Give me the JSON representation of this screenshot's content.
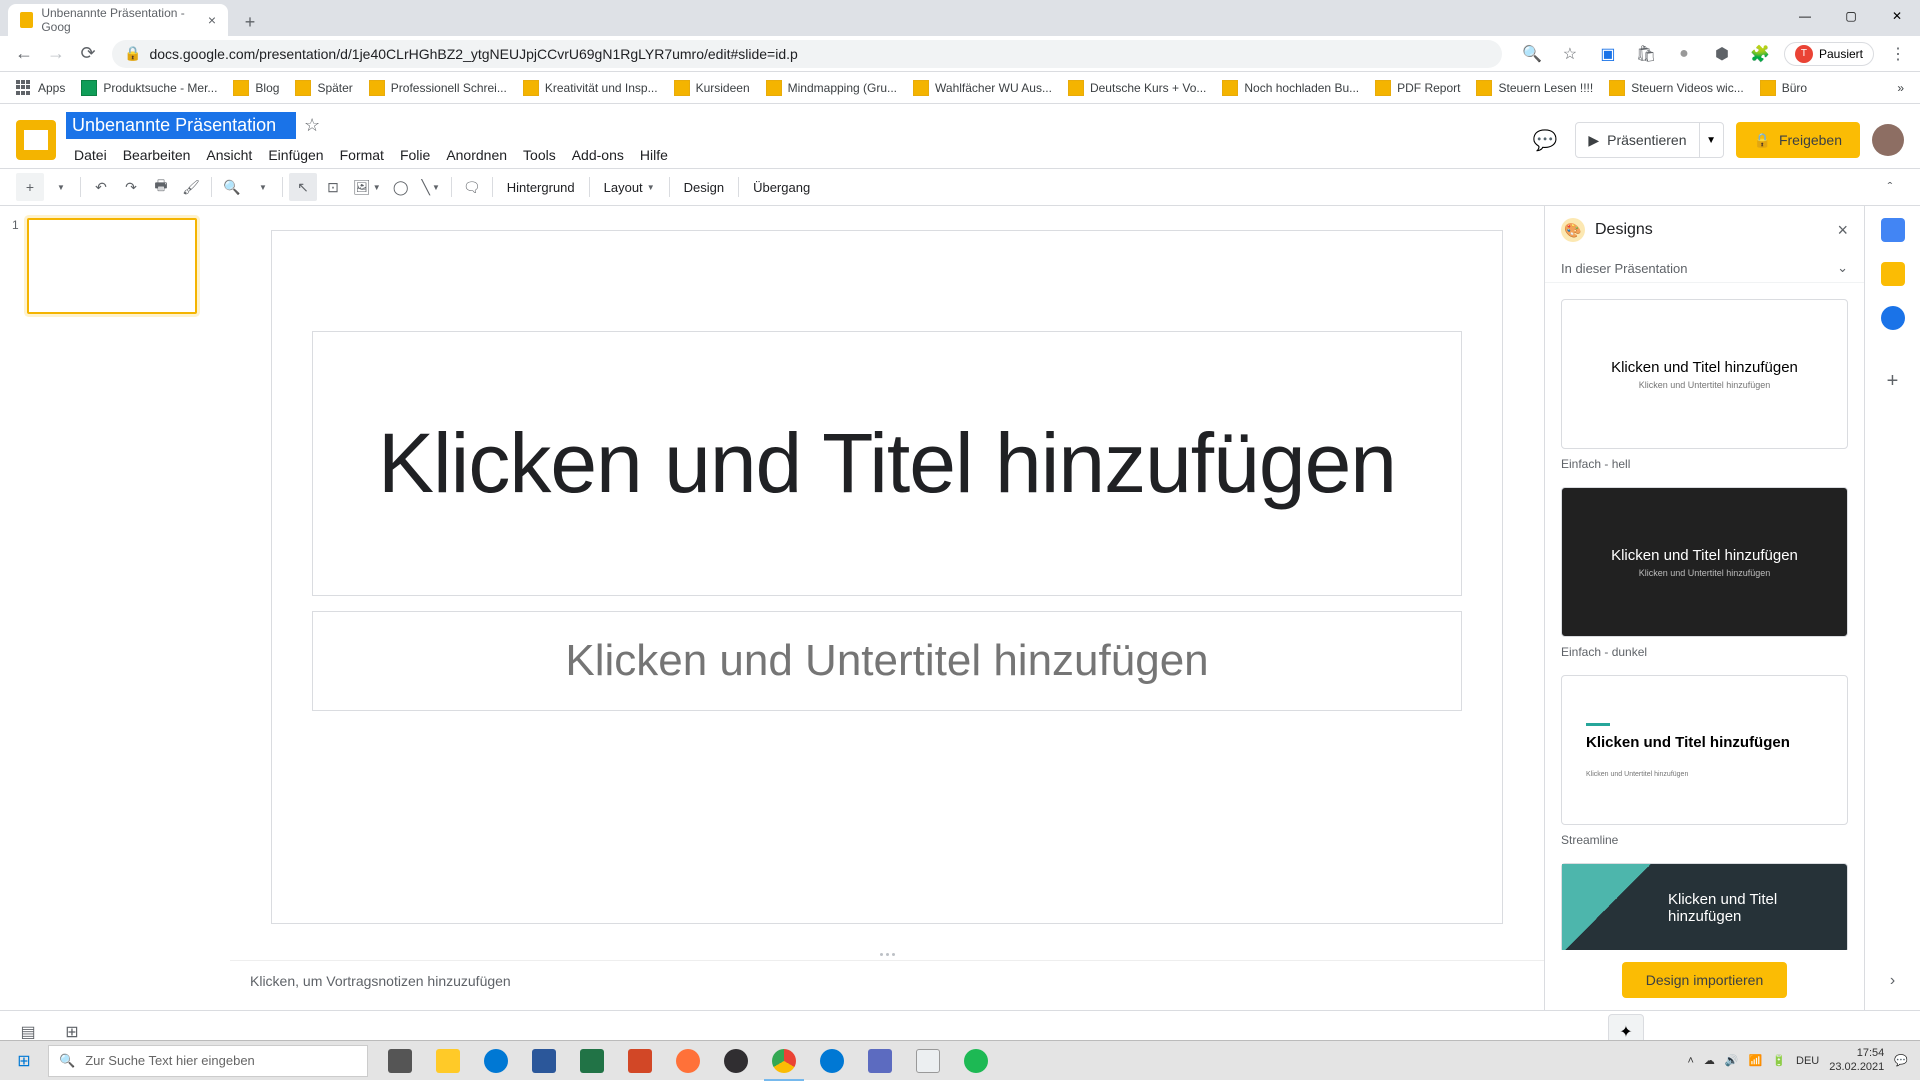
{
  "browser": {
    "tab_title": "Unbenannte Präsentation - Goog",
    "url": "docs.google.com/presentation/d/1je40CLrHGhBZ2_ytgNEUJpjCCvrU69gN1RgLYR7umro/edit#slide=id.p",
    "paused": "Pausiert"
  },
  "bookmarks": [
    "Apps",
    "Produktsuche - Mer...",
    "Blog",
    "Später",
    "Professionell Schrei...",
    "Kreativität und Insp...",
    "Kursideen",
    "Mindmapping (Gru...",
    "Wahlfächer WU Aus...",
    "Deutsche Kurs + Vo...",
    "Noch hochladen Bu...",
    "PDF Report",
    "Steuern Lesen !!!!",
    "Steuern Videos wic...",
    "Büro"
  ],
  "doc": {
    "title": "Unbenannte Präsentation"
  },
  "menus": [
    "Datei",
    "Bearbeiten",
    "Ansicht",
    "Einfügen",
    "Format",
    "Folie",
    "Anordnen",
    "Tools",
    "Add-ons",
    "Hilfe"
  ],
  "header_actions": {
    "present": "Präsentieren",
    "share": "Freigeben"
  },
  "toolbar": {
    "background": "Hintergrund",
    "layout": "Layout",
    "design": "Design",
    "transition": "Übergang"
  },
  "slide": {
    "number": "1",
    "title_placeholder": "Klicken und Titel hinzufügen",
    "subtitle_placeholder": "Klicken und Untertitel hinzufügen",
    "notes_placeholder": "Klicken, um Vortragsnotizen hinzuzufügen"
  },
  "designs": {
    "title": "Designs",
    "subtitle": "In dieser Präsentation",
    "themes": [
      {
        "name": "Einfach - hell",
        "title": "Klicken und Titel hinzufügen",
        "sub": "Klicken und Untertitel hinzufügen"
      },
      {
        "name": "Einfach - dunkel",
        "title": "Klicken und Titel hinzufügen",
        "sub": "Klicken und Untertitel hinzufügen"
      },
      {
        "name": "Streamline",
        "title": "Klicken und Titel hinzufügen",
        "sub": "Klicken und Untertitel hinzufügen"
      },
      {
        "name": "",
        "title": "Klicken und Titel hinzufügen",
        "sub": ""
      }
    ],
    "import": "Design importieren"
  },
  "taskbar": {
    "search_placeholder": "Zur Suche Text hier eingeben",
    "lang": "DEU",
    "time": "17:54",
    "date": "23.02.2021"
  }
}
